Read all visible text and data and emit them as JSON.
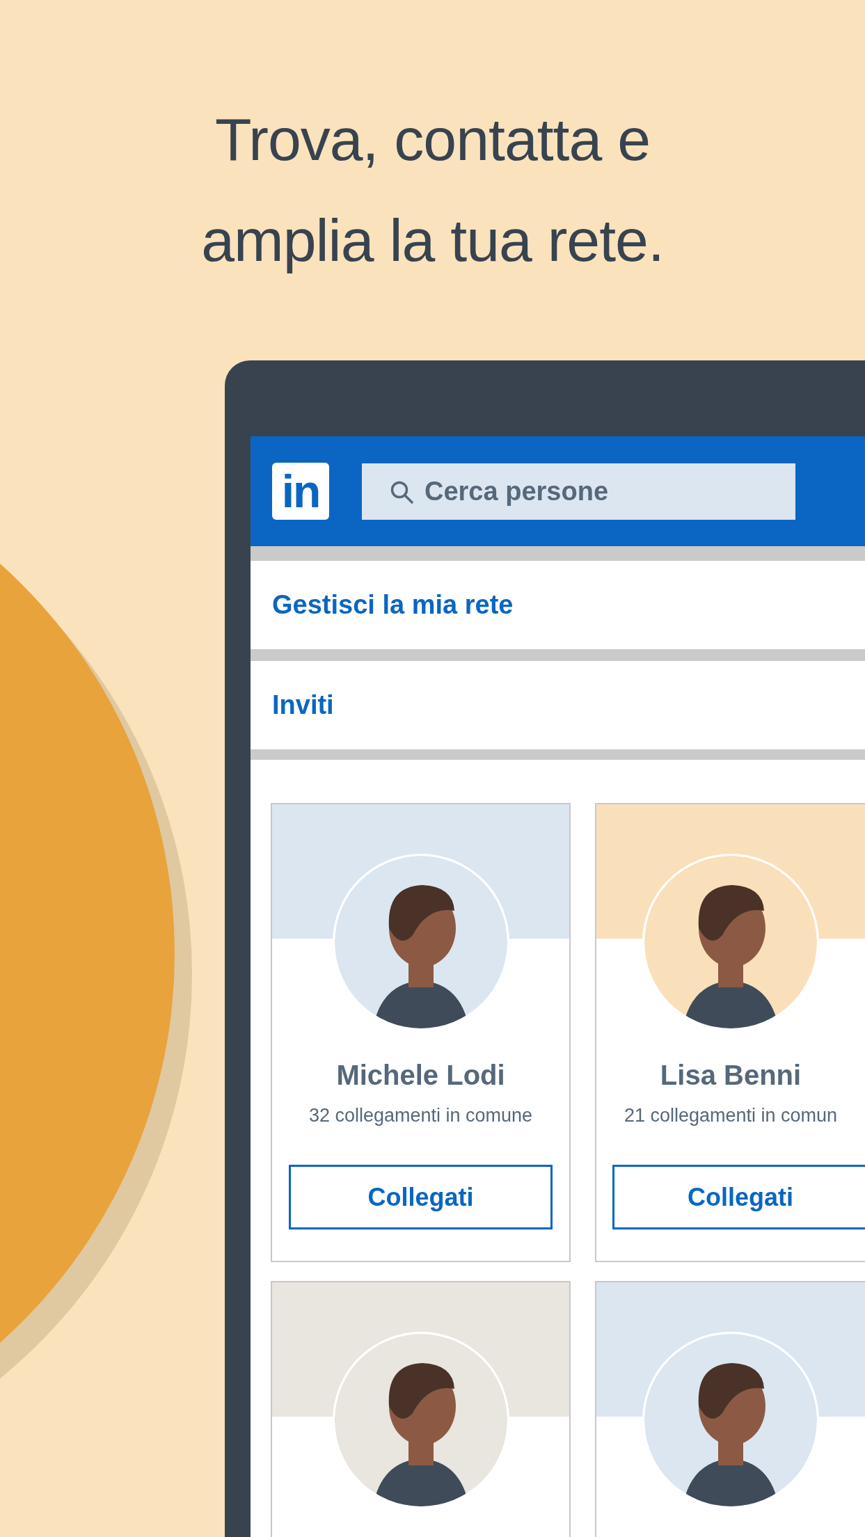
{
  "headline": "Trova, contatta e amplia la tua rete.",
  "header": {
    "logo": "in",
    "search": {
      "placeholder": "Cerca persone"
    }
  },
  "menu": [
    {
      "label": "Gestisci la mia rete"
    },
    {
      "label": "Inviti"
    }
  ],
  "cards": [
    {
      "color": "#dce6f1",
      "name": "Michele Lodi",
      "mutual": "32 collegamenti in comune",
      "button": "Collegati"
    },
    {
      "color": "#f9e0bb",
      "name": "Lisa Benni",
      "mutual": "21 collegamenti in comun",
      "button": "Collegati"
    },
    {
      "color": "#e9e5df"
    },
    {
      "color": "#dce6f1"
    }
  ]
}
